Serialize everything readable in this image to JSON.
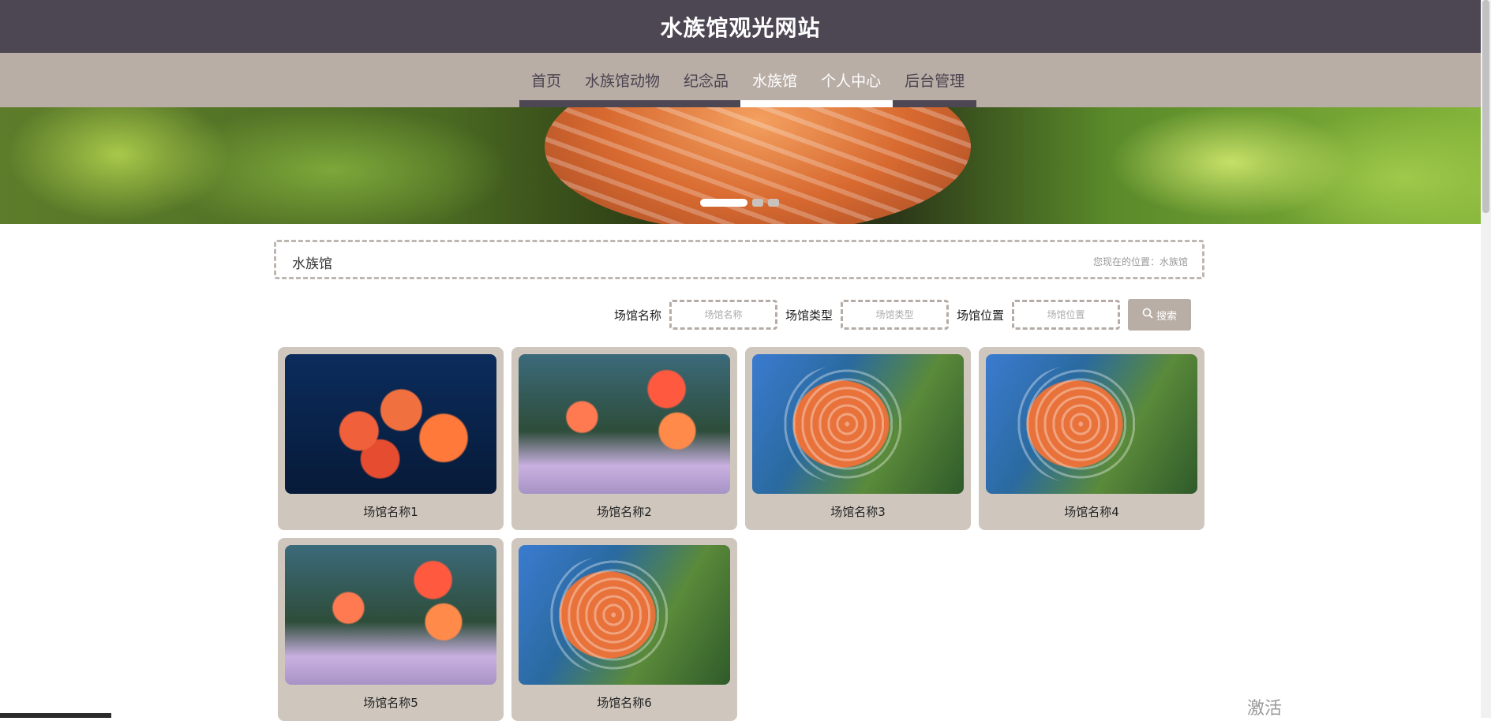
{
  "site_title": "水族馆观光网站",
  "nav": [
    "首页",
    "水族馆动物",
    "纪念品",
    "水族馆",
    "个人中心",
    "后台管理"
  ],
  "crumb": {
    "title": "水族馆",
    "location": "您现在的位置：水族馆"
  },
  "search": {
    "name_label": "场馆名称",
    "name_placeholder": "场馆名称",
    "type_label": "场馆类型",
    "type_placeholder": "场馆类型",
    "location_label": "场馆位置",
    "location_placeholder": "场馆位置",
    "button_label": "搜索"
  },
  "venues": [
    "场馆名称1",
    "场馆名称2",
    "场馆名称3",
    "场馆名称4",
    "场馆名称5",
    "场馆名称6"
  ],
  "watermark": "激活"
}
